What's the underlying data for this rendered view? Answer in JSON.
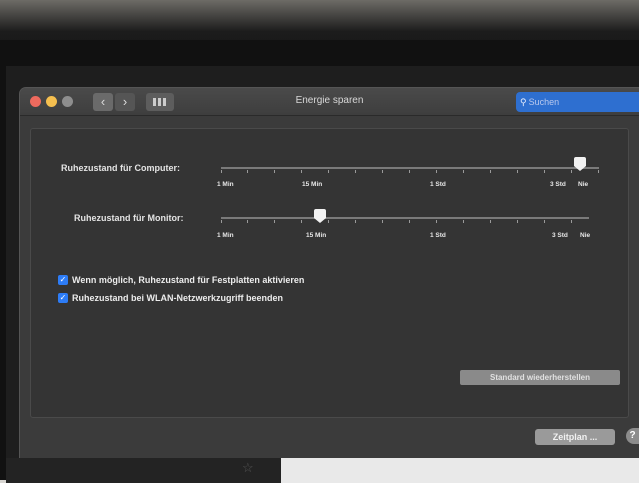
{
  "window": {
    "title": "Energie sparen",
    "search_placeholder": "Suchen"
  },
  "computer_sleep": {
    "label": "Ruhezustand für Computer:",
    "value_label": "Nie",
    "ticks": [
      "1 Min",
      "15 Min",
      "1 Std",
      "3 Std",
      "Nie"
    ]
  },
  "monitor_sleep": {
    "label": "Ruhezustand für Monitor:",
    "value_label": "15 Min",
    "ticks": [
      "1 Min",
      "15 Min",
      "1 Std",
      "3 Std",
      "Nie"
    ]
  },
  "options": [
    {
      "label": "Wenn möglich, Ruhezustand für Festplatten aktivieren",
      "checked": true
    },
    {
      "label": "Ruhezustand bei WLAN-Netzwerkzugriff beenden",
      "checked": true
    }
  ],
  "buttons": {
    "restore_defaults": "Standard wiederherstellen",
    "schedule": "Zeitplan ...",
    "help": "?"
  },
  "icons": {
    "back": "chevron-left-icon",
    "forward": "chevron-right-icon",
    "grid": "grid-icon",
    "search": "search-icon",
    "checkbox": "checkmark-icon"
  },
  "colors": {
    "accent": "#2d7cf6",
    "window_bg": "#3b3b3b"
  }
}
